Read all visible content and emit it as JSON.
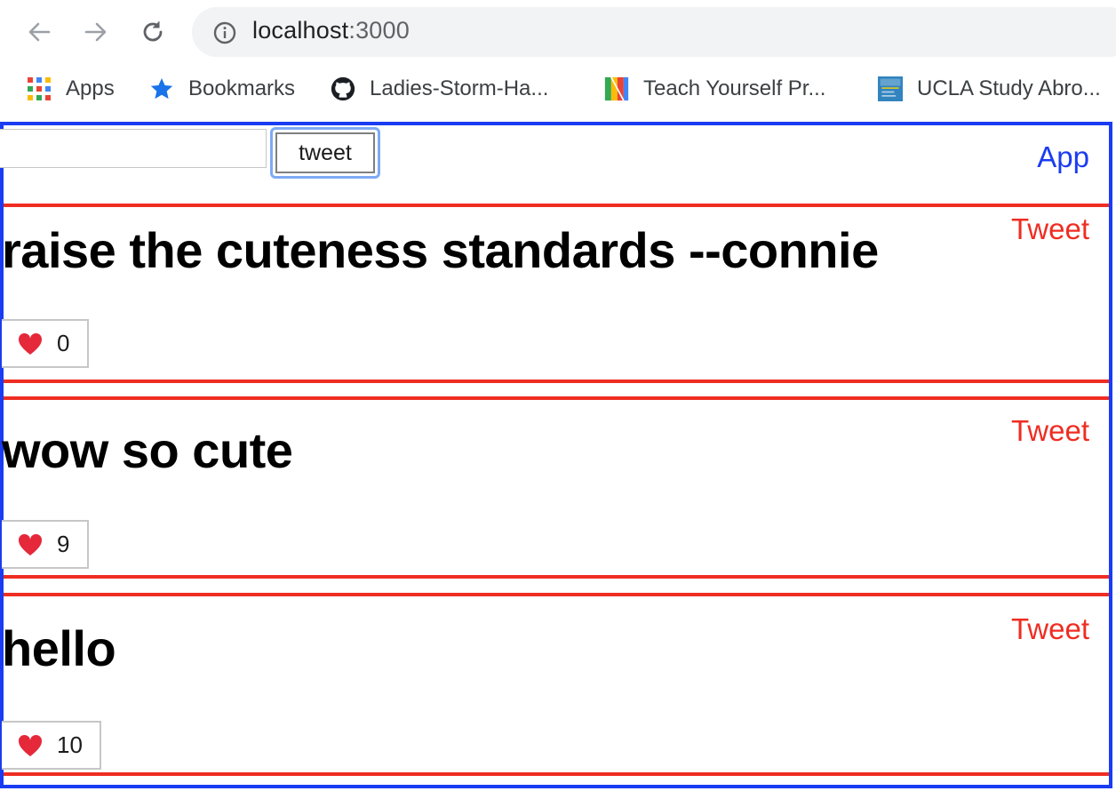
{
  "browser": {
    "url_host": "localhost",
    "url_port": ":3000",
    "bookmarks": [
      {
        "label": "Apps",
        "icon": "apps-grid-icon"
      },
      {
        "label": "Bookmarks",
        "icon": "star-icon"
      },
      {
        "label": "Ladies-Storm-Ha...",
        "icon": "github-icon"
      },
      {
        "label": "Teach Yourself Pr...",
        "icon": "colored-bars-icon"
      },
      {
        "label": "UCLA Study Abro...",
        "icon": "ucla-icon"
      }
    ]
  },
  "app": {
    "label": "App",
    "input_value": "",
    "tweet_button_label": "tweet",
    "tweet_component_label": "Tweet",
    "tweets": [
      {
        "text": "raise the cuteness standards --connie",
        "likes": "0"
      },
      {
        "text": "wow so cute",
        "likes": "9"
      },
      {
        "text": "hello",
        "likes": "10"
      }
    ]
  },
  "colors": {
    "app_border": "#1a3cf2",
    "tweet_border": "#ef2d22",
    "heart": "#e5283a"
  }
}
